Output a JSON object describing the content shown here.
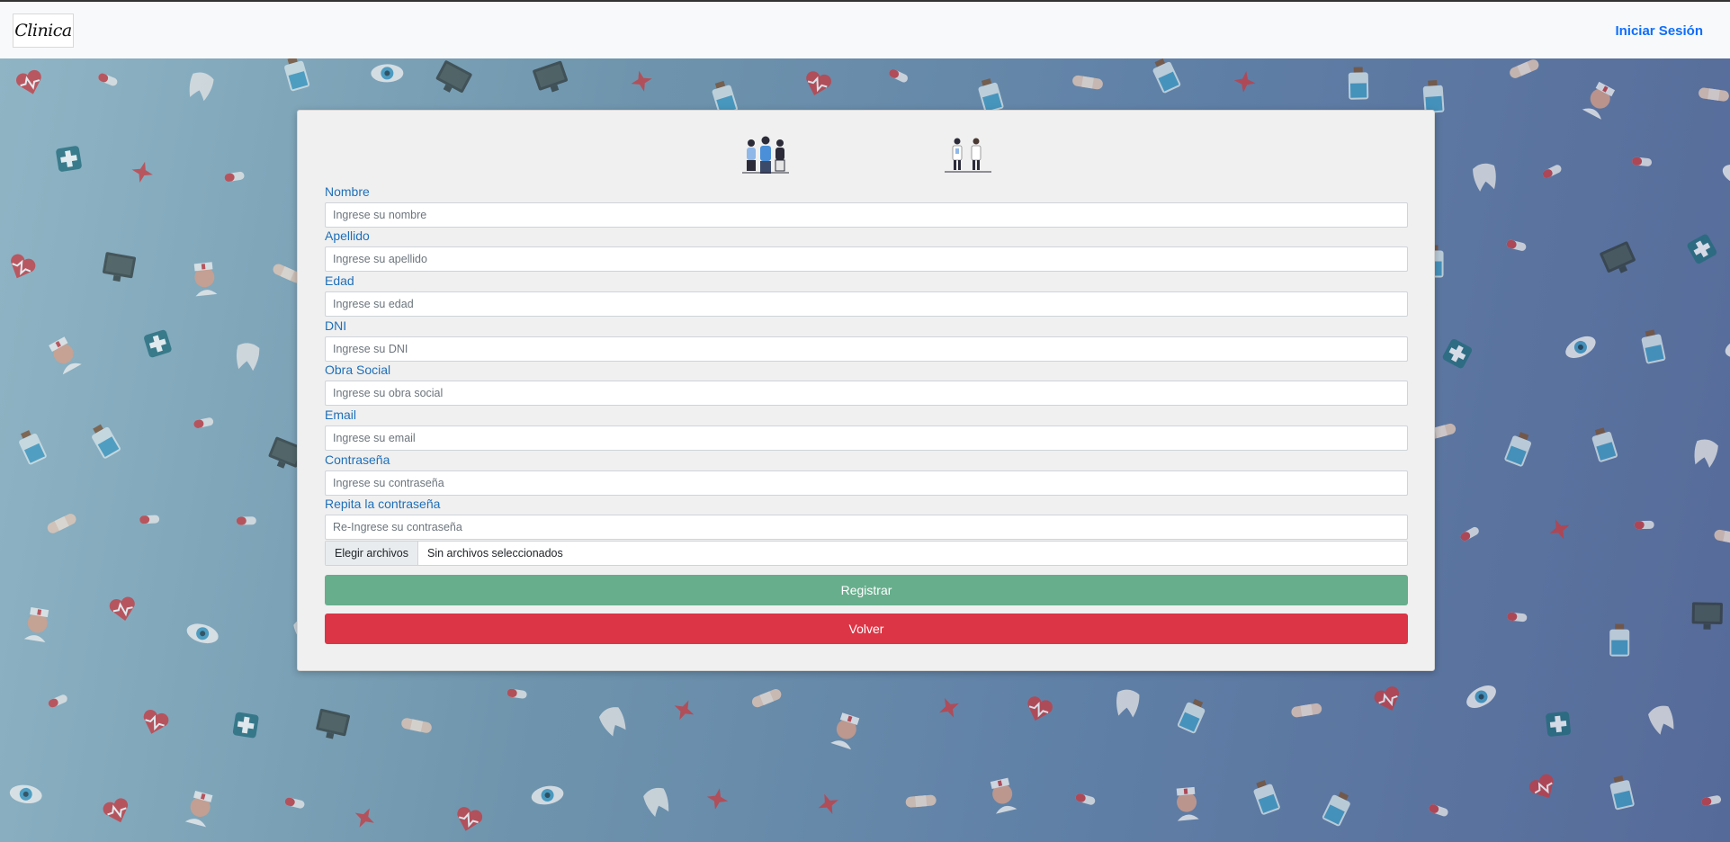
{
  "navbar": {
    "logo_text": "Clinica",
    "login_link": "Iniciar Sesión"
  },
  "form": {
    "icons": [
      "patients-illustration",
      "doctors-illustration"
    ],
    "fields": [
      {
        "label": "Nombre",
        "placeholder": "Ingrese su nombre"
      },
      {
        "label": "Apellido",
        "placeholder": "Ingrese su apellido"
      },
      {
        "label": "Edad",
        "placeholder": "Ingrese su edad"
      },
      {
        "label": "DNI",
        "placeholder": "Ingrese su DNI"
      },
      {
        "label": "Obra Social",
        "placeholder": "Ingrese su obra social"
      },
      {
        "label": "Email",
        "placeholder": "Ingrese su email"
      },
      {
        "label": "Contraseña",
        "placeholder": "Ingrese su contraseña"
      },
      {
        "label": "Repita la contraseña",
        "placeholder": "Re-Ingrese su contraseña"
      }
    ],
    "file": {
      "button_label": "Elegir archivos",
      "status": "Sin archivos seleccionados"
    },
    "register_button": "Registrar",
    "back_button": "Volver"
  },
  "colors": {
    "link": "#0d6efd",
    "label": "#1f6fb8",
    "register": "#67ae8c",
    "back": "#dc3545"
  }
}
